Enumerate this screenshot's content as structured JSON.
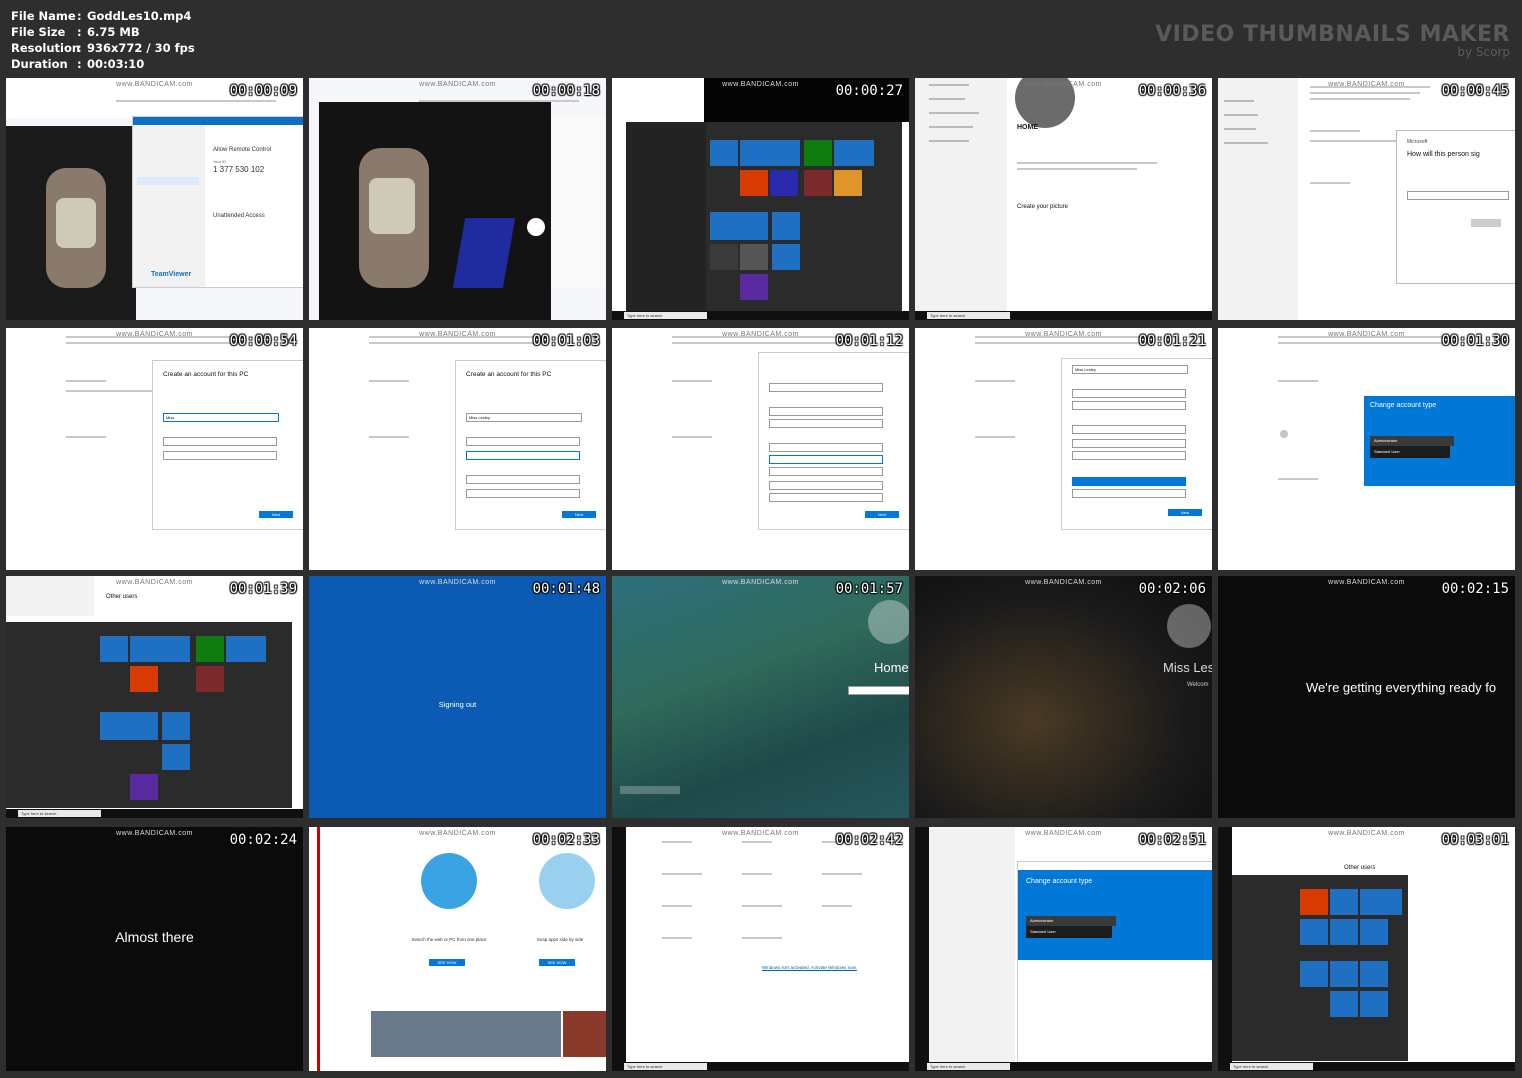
{
  "header": {
    "file_name_label": "File Name",
    "file_name": "GoddLes10.mp4",
    "file_size_label": "File Size",
    "file_size": "6.75 MB",
    "resolution_label": "Resolution",
    "resolution": "936x772 / 30 fps",
    "duration_label": "Duration",
    "duration": "00:03:10",
    "separator": ":"
  },
  "brand": {
    "title": "VIDEO THUMBNAILS MAKER",
    "subtitle": "by Scorp"
  },
  "watermark": "www.BANDICAM.com",
  "taskbar_search": "Type here to search",
  "thumbnails": [
    {
      "time": "00:00:09",
      "caption": "TeamViewer",
      "id_label": "Your ID",
      "id_value": "1 377 530 102",
      "allow": "Allow Remote Control",
      "unattended": "Unattended Access"
    },
    {
      "time": "00:00:18"
    },
    {
      "time": "00:00:27"
    },
    {
      "time": "00:00:36",
      "label": "HOME",
      "sub": "Create your picture"
    },
    {
      "time": "00:00:45",
      "ms_title": "How will this person sig",
      "ms_brand": "Microsoft"
    },
    {
      "time": "00:00:54",
      "heading": "Create an account for this PC",
      "field": "Miss",
      "next": "Next"
    },
    {
      "time": "00:01:03",
      "heading": "Create an account for this PC",
      "field": "Miss Lesley",
      "next": "Next"
    },
    {
      "time": "00:01:12",
      "next": "Next"
    },
    {
      "time": "00:01:21",
      "field": "Miss Lesley",
      "next": "Next"
    },
    {
      "time": "00:01:30",
      "heading": "Change account type",
      "option1": "Administrator",
      "option2": "Standard User"
    },
    {
      "time": "00:01:39",
      "label": "Other users"
    },
    {
      "time": "00:01:48",
      "message": "Signing out"
    },
    {
      "time": "00:01:57",
      "user": "Home"
    },
    {
      "time": "00:02:06",
      "user": "Miss Les",
      "welcome": "Welcom"
    },
    {
      "time": "00:02:15",
      "message": "We're getting everything ready fo"
    },
    {
      "time": "00:02:24",
      "message": "Almost there"
    },
    {
      "time": "00:02:33",
      "left": "Search the web or PC from one place",
      "right": "Snap apps side by side",
      "see_how": "SEE HOW"
    },
    {
      "time": "00:02:42",
      "activate": "Windows isn't activated. Activate Windows now."
    },
    {
      "time": "00:02:51",
      "heading": "Change account type",
      "option1": "Administrator",
      "option2": "Standard User"
    },
    {
      "time": "00:03:01",
      "label": "Other users"
    }
  ]
}
